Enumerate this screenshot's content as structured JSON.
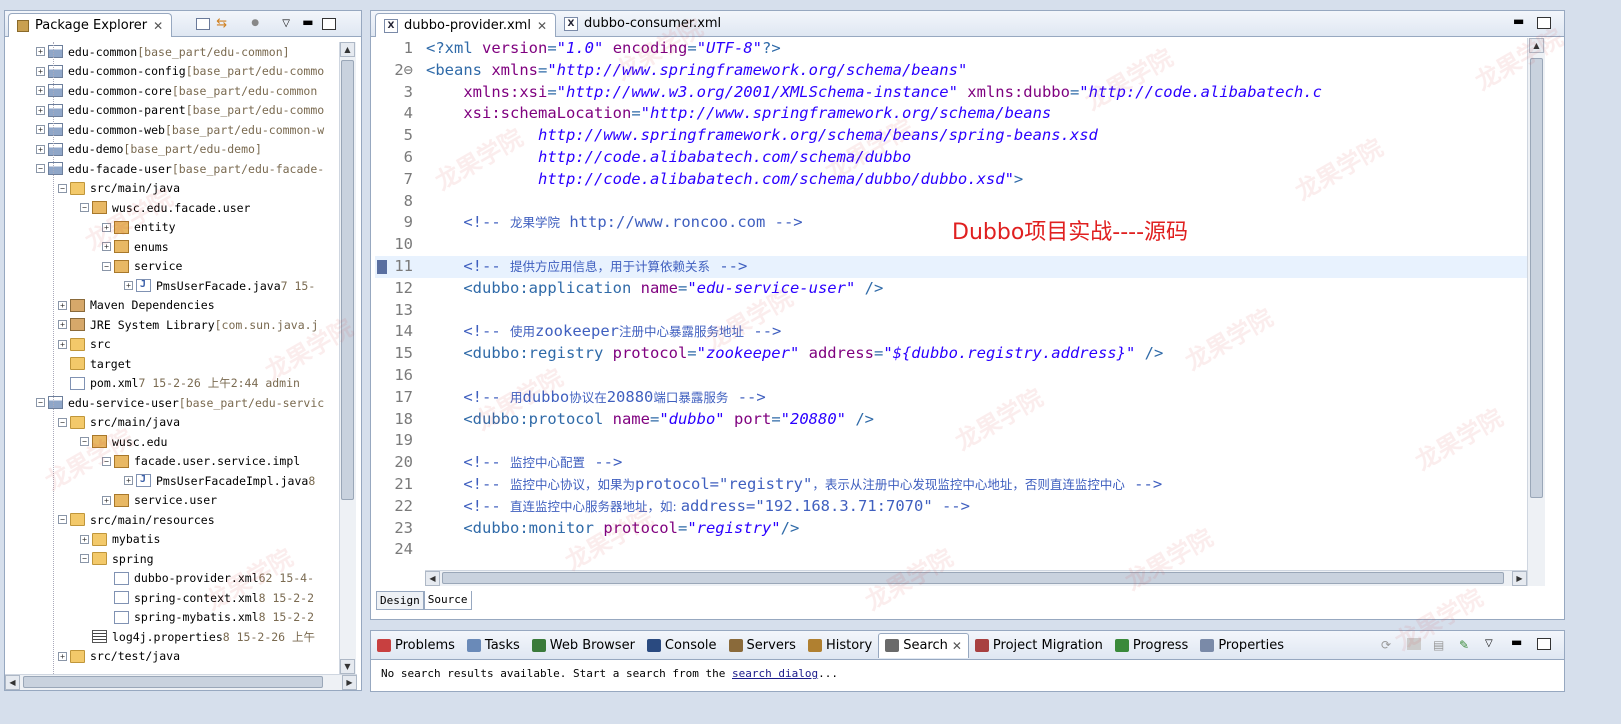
{
  "explorer": {
    "title": "Package Explorer",
    "tree": [
      {
        "d": 0,
        "e": "+",
        "i": "proj",
        "n": "edu-common",
        "x": " [base_part/edu-common]"
      },
      {
        "d": 0,
        "e": "+",
        "i": "proj",
        "n": "edu-common-config",
        "x": " [base_part/edu-commo"
      },
      {
        "d": 0,
        "e": "+",
        "i": "proj",
        "n": "edu-common-core",
        "x": " [base_part/edu-common"
      },
      {
        "d": 0,
        "e": "+",
        "i": "proj",
        "n": "edu-common-parent",
        "x": " [base_part/edu-commo"
      },
      {
        "d": 0,
        "e": "+",
        "i": "proj",
        "n": "edu-common-web",
        "x": " [base_part/edu-common-w"
      },
      {
        "d": 0,
        "e": "+",
        "i": "proj",
        "n": "edu-demo",
        "x": " [base_part/edu-demo]"
      },
      {
        "d": 0,
        "e": "-",
        "i": "proj",
        "n": "edu-facade-user",
        "x": " [base_part/edu-facade-"
      },
      {
        "d": 1,
        "e": "-",
        "i": "folder",
        "n": "src/main/java",
        "x": ""
      },
      {
        "d": 2,
        "e": "-",
        "i": "pkg",
        "n": "wusc.edu.facade.user",
        "x": ""
      },
      {
        "d": 3,
        "e": "+",
        "i": "pkg",
        "n": "entity",
        "x": ""
      },
      {
        "d": 3,
        "e": "+",
        "i": "pkg",
        "n": "enums",
        "x": ""
      },
      {
        "d": 3,
        "e": "-",
        "i": "pkg",
        "n": "service",
        "x": ""
      },
      {
        "d": 4,
        "e": "+",
        "i": "java",
        "n": "PmsUserFacade.java",
        "x": " 7  15-"
      },
      {
        "d": 1,
        "e": "+",
        "i": "jar",
        "n": "Maven Dependencies",
        "x": ""
      },
      {
        "d": 1,
        "e": "+",
        "i": "jar",
        "n": "JRE System Library",
        "x": " [com.sun.java.j"
      },
      {
        "d": 1,
        "e": "+",
        "i": "folder",
        "n": "src",
        "x": ""
      },
      {
        "d": 1,
        "e": "",
        "i": "folder",
        "n": "target",
        "x": ""
      },
      {
        "d": 1,
        "e": "",
        "i": "file",
        "n": "pom.xml",
        "x": " 7  15-2-26 上午2:44  admin"
      },
      {
        "d": 0,
        "e": "-",
        "i": "proj",
        "n": "edu-service-user",
        "x": " [base_part/edu-servic"
      },
      {
        "d": 1,
        "e": "-",
        "i": "folder",
        "n": "src/main/java",
        "x": ""
      },
      {
        "d": 2,
        "e": "-",
        "i": "pkg",
        "n": "wusc.edu",
        "x": ""
      },
      {
        "d": 3,
        "e": "-",
        "i": "pkg",
        "n": "facade.user.service.impl",
        "x": ""
      },
      {
        "d": 4,
        "e": "+",
        "i": "java",
        "n": "PmsUserFacadeImpl.java",
        "x": " 8"
      },
      {
        "d": 3,
        "e": "+",
        "i": "pkg",
        "n": "service.user",
        "x": ""
      },
      {
        "d": 1,
        "e": "-",
        "i": "folder",
        "n": "src/main/resources",
        "x": ""
      },
      {
        "d": 2,
        "e": "+",
        "i": "folder",
        "n": "mybatis",
        "x": ""
      },
      {
        "d": 2,
        "e": "-",
        "i": "folder",
        "n": "spring",
        "x": ""
      },
      {
        "d": 3,
        "e": "",
        "i": "file",
        "n": "dubbo-provider.xml",
        "x": " 62  15-4-"
      },
      {
        "d": 3,
        "e": "",
        "i": "file",
        "n": "spring-context.xml",
        "x": " 8  15-2-2"
      },
      {
        "d": 3,
        "e": "",
        "i": "file",
        "n": "spring-mybatis.xml",
        "x": " 8  15-2-2"
      },
      {
        "d": 2,
        "e": "",
        "i": "props",
        "n": "log4j.properties",
        "x": " 8  15-2-26 上午"
      },
      {
        "d": 1,
        "e": "+",
        "i": "folder",
        "n": "src/test/java",
        "x": ""
      }
    ]
  },
  "editor_tabs": [
    {
      "label": "dubbo-provider.xml",
      "active": true
    },
    {
      "label": "dubbo-consumer.xml",
      "active": false
    }
  ],
  "code_lines": [
    {
      "n": "1",
      "t": [
        [
          "tag",
          "<?xml "
        ],
        [
          "attr",
          "version"
        ],
        [
          "tag",
          "="
        ],
        [
          "str",
          "\"1.0\""
        ],
        [
          "tag",
          " "
        ],
        [
          "attr",
          "encoding"
        ],
        [
          "tag",
          "="
        ],
        [
          "str",
          "\"UTF-8\""
        ],
        [
          "tag",
          "?>"
        ]
      ]
    },
    {
      "n": "2⊖",
      "t": [
        [
          "tag",
          "<beans "
        ],
        [
          "attr",
          "xmlns"
        ],
        [
          "tag",
          "="
        ],
        [
          "str",
          "\"http://www.springframework.org/schema/beans\""
        ]
      ]
    },
    {
      "n": "3",
      "t": [
        [
          "p",
          "    "
        ],
        [
          "attr",
          "xmlns:xsi"
        ],
        [
          "tag",
          "="
        ],
        [
          "str",
          "\"http://www.w3.org/2001/XMLSchema-instance\""
        ],
        [
          "p",
          " "
        ],
        [
          "attr",
          "xmlns:dubbo"
        ],
        [
          "tag",
          "="
        ],
        [
          "str",
          "\"http://code.alibabatech.c"
        ]
      ]
    },
    {
      "n": "4",
      "t": [
        [
          "p",
          "    "
        ],
        [
          "attr",
          "xsi:schemaLocation"
        ],
        [
          "tag",
          "="
        ],
        [
          "str",
          "\"http://www.springframework.org/schema/beans"
        ]
      ]
    },
    {
      "n": "5",
      "t": [
        [
          "str",
          "            http://www.springframework.org/schema/beans/spring-beans.xsd"
        ]
      ]
    },
    {
      "n": "6",
      "t": [
        [
          "str",
          "            http://code.alibabatech.com/schema/dubbo"
        ]
      ]
    },
    {
      "n": "7",
      "t": [
        [
          "str",
          "            http://code.alibabatech.com/schema/dubbo/dubbo.xsd\""
        ],
        [
          "tag",
          ">"
        ]
      ]
    },
    {
      "n": "8",
      "t": []
    },
    {
      "n": "9",
      "t": [
        [
          "p",
          "    "
        ],
        [
          "cmt",
          "<!-- "
        ],
        [
          "cmtcn",
          "龙果学院"
        ],
        [
          "cmt",
          " http://www.roncoo.com -->"
        ]
      ]
    },
    {
      "n": "10",
      "t": []
    },
    {
      "n": "11",
      "t": [
        [
          "p",
          "    "
        ],
        [
          "cmt",
          "<!-- "
        ],
        [
          "cmtcn",
          "提供方应用信息，用于计算依赖关系"
        ],
        [
          "cmt",
          " -->"
        ]
      ],
      "hl": true
    },
    {
      "n": "12",
      "t": [
        [
          "p",
          "    "
        ],
        [
          "tag",
          "<dubbo:application "
        ],
        [
          "attr",
          "name"
        ],
        [
          "tag",
          "="
        ],
        [
          "str",
          "\"edu-service-user\""
        ],
        [
          "tag",
          " />"
        ]
      ]
    },
    {
      "n": "13",
      "t": []
    },
    {
      "n": "14",
      "t": [
        [
          "p",
          "    "
        ],
        [
          "cmt",
          "<!-- "
        ],
        [
          "cmtcn",
          "使用"
        ],
        [
          "cmt",
          "zookeeper"
        ],
        [
          "cmtcn",
          "注册中心暴露服务地址"
        ],
        [
          "cmt",
          " -->"
        ]
      ]
    },
    {
      "n": "15",
      "t": [
        [
          "p",
          "    "
        ],
        [
          "tag",
          "<dubbo:registry "
        ],
        [
          "attr",
          "protocol"
        ],
        [
          "tag",
          "="
        ],
        [
          "str",
          "\"zookeeper\""
        ],
        [
          "p",
          " "
        ],
        [
          "attr",
          "address"
        ],
        [
          "tag",
          "="
        ],
        [
          "str",
          "\"${dubbo.registry.address}\""
        ],
        [
          "tag",
          " />"
        ]
      ]
    },
    {
      "n": "16",
      "t": []
    },
    {
      "n": "17",
      "t": [
        [
          "p",
          "    "
        ],
        [
          "cmt",
          "<!-- "
        ],
        [
          "cmtcn",
          "用"
        ],
        [
          "cmt",
          "dubbo"
        ],
        [
          "cmtcn",
          "协议在"
        ],
        [
          "cmt",
          "20880"
        ],
        [
          "cmtcn",
          "端口暴露服务"
        ],
        [
          "cmt",
          " -->"
        ]
      ]
    },
    {
      "n": "18",
      "t": [
        [
          "p",
          "    "
        ],
        [
          "tag",
          "<dubbo:protocol "
        ],
        [
          "attr",
          "name"
        ],
        [
          "tag",
          "="
        ],
        [
          "str",
          "\"dubbo\""
        ],
        [
          "p",
          " "
        ],
        [
          "attr",
          "port"
        ],
        [
          "tag",
          "="
        ],
        [
          "str",
          "\"20880\""
        ],
        [
          "tag",
          " />"
        ]
      ]
    },
    {
      "n": "19",
      "t": []
    },
    {
      "n": "20",
      "t": [
        [
          "p",
          "    "
        ],
        [
          "cmt",
          "<!-- "
        ],
        [
          "cmtcn",
          "监控中心配置"
        ],
        [
          "cmt",
          " -->"
        ]
      ]
    },
    {
      "n": "21",
      "t": [
        [
          "p",
          "    "
        ],
        [
          "cmt",
          "<!-- "
        ],
        [
          "cmtcn",
          "监控中心协议，如果为"
        ],
        [
          "cmt",
          "protocol=\"registry\""
        ],
        [
          "cmtcn",
          "，表示从注册中心发现监控中心地址，否则直连监控中心"
        ],
        [
          "cmt",
          " -->"
        ]
      ]
    },
    {
      "n": "22",
      "t": [
        [
          "p",
          "    "
        ],
        [
          "cmt",
          "<!-- "
        ],
        [
          "cmtcn",
          "直连监控中心服务器地址，如: "
        ],
        [
          "cmt",
          "address=\"192.168.3.71:7070\" -->"
        ]
      ]
    },
    {
      "n": "23",
      "t": [
        [
          "p",
          "    "
        ],
        [
          "tag",
          "<dubbo:monitor "
        ],
        [
          "attr",
          "protocol"
        ],
        [
          "tag",
          "="
        ],
        [
          "str",
          "\"registry\""
        ],
        [
          "tag",
          "/>"
        ]
      ]
    },
    {
      "n": "24",
      "t": []
    }
  ],
  "overlay_title": "Dubbo项目实战----源码",
  "view_tabs": [
    "Design",
    "Source"
  ],
  "bottom_tabs": [
    {
      "label": "Problems",
      "c": "#c84040"
    },
    {
      "label": "Tasks",
      "c": "#6a8ab8"
    },
    {
      "label": "Web Browser",
      "c": "#3a7a3a"
    },
    {
      "label": "Console",
      "c": "#2a4a80"
    },
    {
      "label": "Servers",
      "c": "#8a6a3a"
    },
    {
      "label": "History",
      "c": "#b08030"
    },
    {
      "label": "Search",
      "c": "#6a6a6a",
      "active": true
    },
    {
      "label": "Project Migration",
      "c": "#a84040"
    },
    {
      "label": "Progress",
      "c": "#3a8a3a"
    },
    {
      "label": "Properties",
      "c": "#7a8aa8"
    }
  ],
  "search": {
    "message": "No search results available. Start a search from the ",
    "link": "search dialog",
    "suffix": "..."
  },
  "watermark": "龙果学院"
}
